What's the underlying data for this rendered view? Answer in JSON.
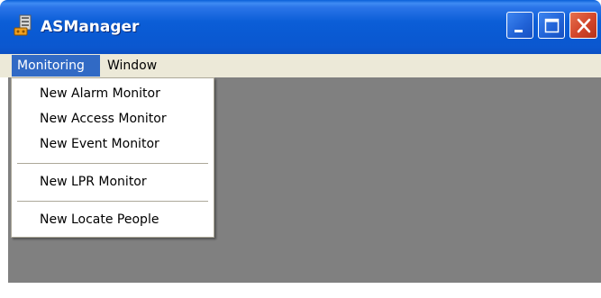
{
  "window": {
    "title": "ASManager",
    "app_icon": "server-app-icon",
    "controls": {
      "minimize_icon": "minimize-icon",
      "maximize_icon": "maximize-icon",
      "close_icon": "close-icon"
    }
  },
  "menubar": {
    "items": [
      {
        "label": "Monitoring",
        "state": "open"
      },
      {
        "label": "Window"
      }
    ]
  },
  "dropdown": {
    "items": [
      {
        "label": "New Alarm Monitor"
      },
      {
        "label": "New Access Monitor"
      },
      {
        "label": "New Event Monitor"
      },
      {
        "label": "New LPR Monitor"
      },
      {
        "label": "New Locate People"
      }
    ]
  },
  "colors": {
    "titlebar": "#0b5ed7",
    "menu_highlight": "#316ac5",
    "menubar": "#ece9d8",
    "client_area": "#808080",
    "close_button": "#d2452a"
  }
}
